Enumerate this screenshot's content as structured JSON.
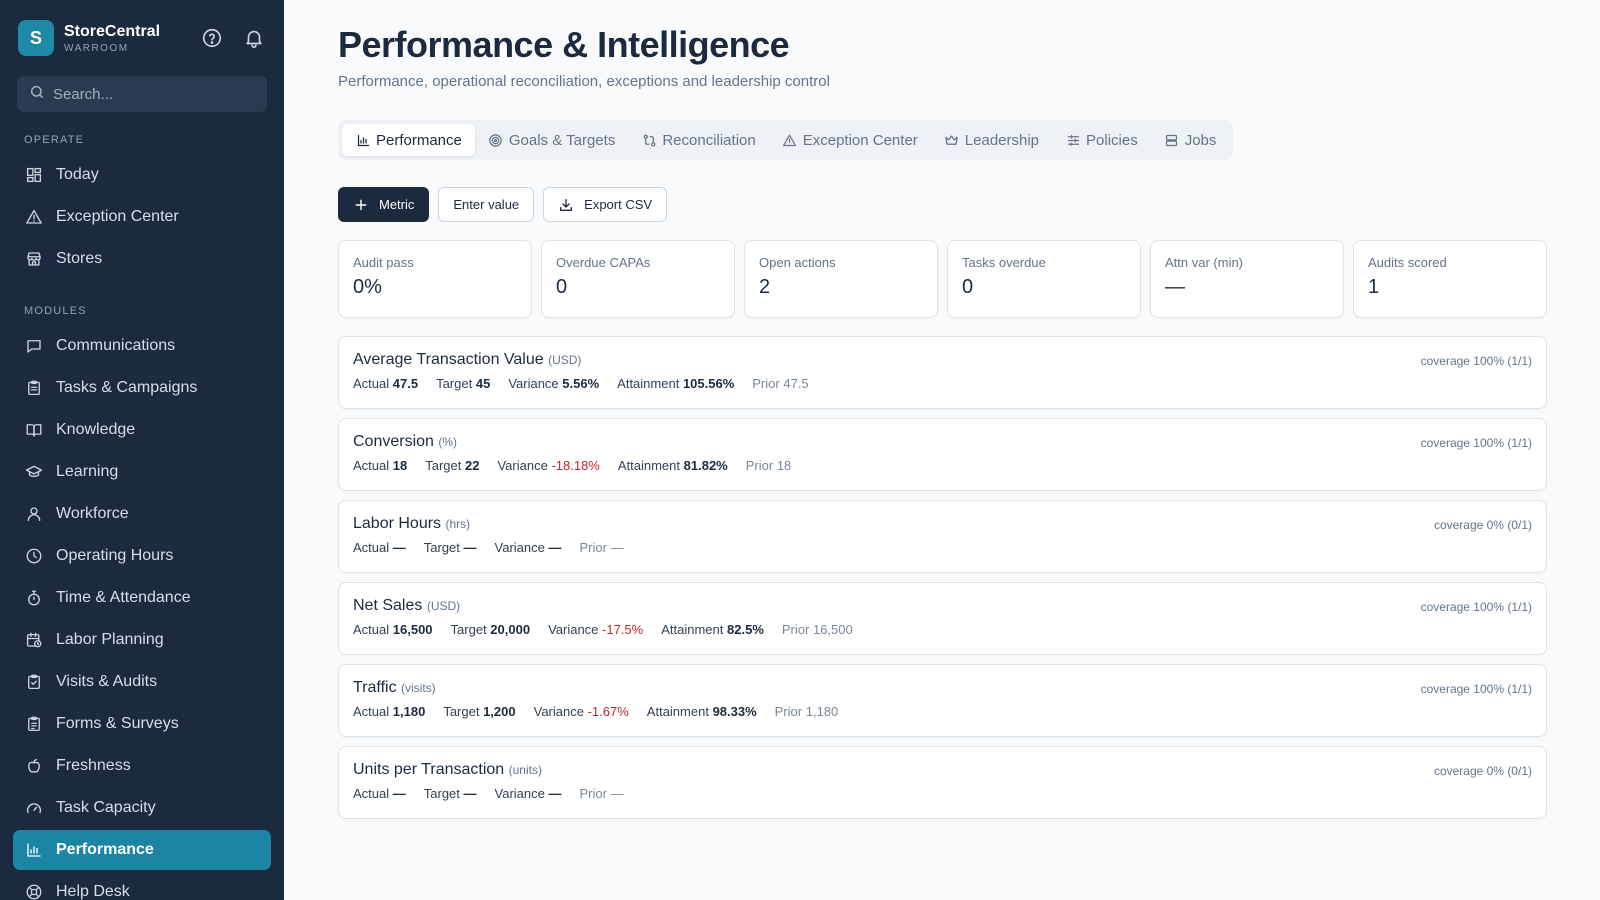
{
  "brand": {
    "logo_letter": "S",
    "name": "StoreCentral",
    "sub": "WARROOM"
  },
  "search": {
    "placeholder": "Search..."
  },
  "sidebar": {
    "operate_label": "OPERATE",
    "operate": [
      {
        "label": "Today",
        "icon": "grid-icon"
      },
      {
        "label": "Exception Center",
        "icon": "alert-triangle-icon"
      },
      {
        "label": "Stores",
        "icon": "store-icon"
      }
    ],
    "modules_label": "MODULES",
    "modules": [
      {
        "label": "Communications",
        "icon": "message-icon"
      },
      {
        "label": "Tasks & Campaigns",
        "icon": "clipboard-icon"
      },
      {
        "label": "Knowledge",
        "icon": "book-icon"
      },
      {
        "label": "Learning",
        "icon": "graduation-cap-icon"
      },
      {
        "label": "Workforce",
        "icon": "user-icon"
      },
      {
        "label": "Operating Hours",
        "icon": "clock-icon"
      },
      {
        "label": "Time & Attendance",
        "icon": "timer-icon"
      },
      {
        "label": "Labor Planning",
        "icon": "calendar-clock-icon"
      },
      {
        "label": "Visits & Audits",
        "icon": "clipboard-check-icon"
      },
      {
        "label": "Forms & Surveys",
        "icon": "clipboard-list-icon"
      },
      {
        "label": "Freshness",
        "icon": "apple-icon"
      },
      {
        "label": "Task Capacity",
        "icon": "gauge-icon"
      },
      {
        "label": "Performance",
        "icon": "bar-chart-icon",
        "active": true
      },
      {
        "label": "Help Desk",
        "icon": "lifebuoy-icon"
      }
    ]
  },
  "page": {
    "title": "Performance & Intelligence",
    "subtitle": "Performance, operational reconciliation, exceptions and leadership control"
  },
  "tabs": [
    {
      "label": "Performance",
      "icon": "bar-chart-icon",
      "active": true
    },
    {
      "label": "Goals & Targets",
      "icon": "target-icon"
    },
    {
      "label": "Reconciliation",
      "icon": "git-compare-icon"
    },
    {
      "label": "Exception Center",
      "icon": "alert-triangle-icon"
    },
    {
      "label": "Leadership",
      "icon": "crown-icon"
    },
    {
      "label": "Policies",
      "icon": "sliders-icon"
    },
    {
      "label": "Jobs",
      "icon": "server-icon"
    }
  ],
  "actions": {
    "metric": "Metric",
    "enter_value": "Enter value",
    "export_csv": "Export CSV"
  },
  "kpis": [
    {
      "label": "Audit pass",
      "value": "0%"
    },
    {
      "label": "Overdue CAPAs",
      "value": "0"
    },
    {
      "label": "Open actions",
      "value": "2"
    },
    {
      "label": "Tasks overdue",
      "value": "0"
    },
    {
      "label": "Attn var (min)",
      "value": "—"
    },
    {
      "label": "Audits scored",
      "value": "1"
    }
  ],
  "labels": {
    "actual": "Actual",
    "target": "Target",
    "variance": "Variance",
    "attainment": "Attainment",
    "prior": "Prior"
  },
  "metrics": [
    {
      "name": "Average Transaction Value",
      "unit": "(USD)",
      "coverage": "coverage 100% (1/1)",
      "actual": "47.5",
      "target": "45",
      "variance": "5.56%",
      "variance_negative": false,
      "attainment": "105.56%",
      "prior": "47.5"
    },
    {
      "name": "Conversion",
      "unit": "(%)",
      "coverage": "coverage 100% (1/1)",
      "actual": "18",
      "target": "22",
      "variance": "-18.18%",
      "variance_negative": true,
      "attainment": "81.82%",
      "prior": "18"
    },
    {
      "name": "Labor Hours",
      "unit": "(hrs)",
      "coverage": "coverage 0% (0/1)",
      "actual": "—",
      "target": "—",
      "variance": "—",
      "variance_negative": false,
      "attainment": null,
      "prior": "—"
    },
    {
      "name": "Net Sales",
      "unit": "(USD)",
      "coverage": "coverage 100% (1/1)",
      "actual": "16,500",
      "target": "20,000",
      "variance": "-17.5%",
      "variance_negative": true,
      "attainment": "82.5%",
      "prior": "16,500"
    },
    {
      "name": "Traffic",
      "unit": "(visits)",
      "coverage": "coverage 100% (1/1)",
      "actual": "1,180",
      "target": "1,200",
      "variance": "-1.67%",
      "variance_negative": true,
      "attainment": "98.33%",
      "prior": "1,180"
    },
    {
      "name": "Units per Transaction",
      "unit": "(units)",
      "coverage": "coverage 0% (0/1)",
      "actual": "—",
      "target": "—",
      "variance": "—",
      "variance_negative": false,
      "attainment": null,
      "prior": "—"
    }
  ],
  "colors": {
    "sidebar_bg": "#1c2a40",
    "accent": "#1a86a3",
    "negative": "#c0262d"
  }
}
